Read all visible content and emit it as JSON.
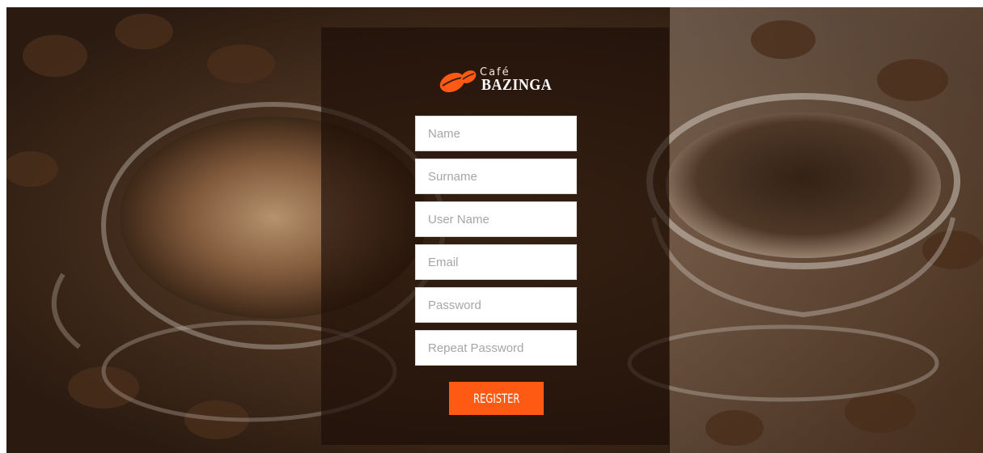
{
  "brand": {
    "cafe_text": "Café",
    "name_text": "BAZINGA",
    "accent_color": "#ff5a14"
  },
  "form": {
    "fields": [
      {
        "id": "name",
        "placeholder": "Name",
        "value": ""
      },
      {
        "id": "surname",
        "placeholder": "Surname",
        "value": ""
      },
      {
        "id": "username",
        "placeholder": "User Name",
        "value": ""
      },
      {
        "id": "email",
        "placeholder": "Email",
        "value": ""
      },
      {
        "id": "password",
        "placeholder": "Password",
        "value": ""
      },
      {
        "id": "repeat-password",
        "placeholder": "Repeat Password",
        "value": ""
      }
    ],
    "submit_label": "REGISTER"
  },
  "icons": {
    "logo": "coffee-beans-icon"
  }
}
